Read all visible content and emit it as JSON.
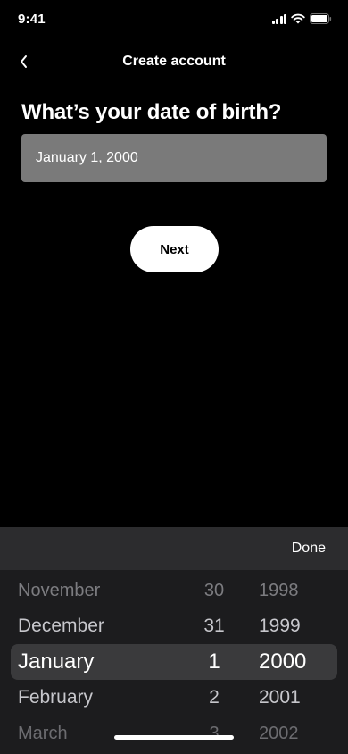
{
  "status_bar": {
    "time": "9:41"
  },
  "nav": {
    "title": "Create account"
  },
  "heading": "What’s your date of birth?",
  "date_field": {
    "value": "January 1, 2000"
  },
  "next_button": {
    "label": "Next"
  },
  "picker": {
    "done_label": "Done",
    "rows": [
      {
        "month": "November",
        "day": "30",
        "year": "1998"
      },
      {
        "month": "December",
        "day": "31",
        "year": "1999"
      },
      {
        "month": "January",
        "day": "1",
        "year": "2000"
      },
      {
        "month": "February",
        "day": "2",
        "year": "2001"
      },
      {
        "month": "March",
        "day": "3",
        "year": "2002"
      }
    ],
    "selected_index": 2
  },
  "colors": {
    "background": "#000000",
    "field_bg": "#7a7a7a",
    "picker_bg": "#1c1c1e",
    "toolbar_bg": "#2c2c2e",
    "selection_bg": "#3a3a3c"
  },
  "icons": [
    "signal-icon",
    "wifi-icon",
    "battery-icon",
    "chevron-left-icon"
  ]
}
